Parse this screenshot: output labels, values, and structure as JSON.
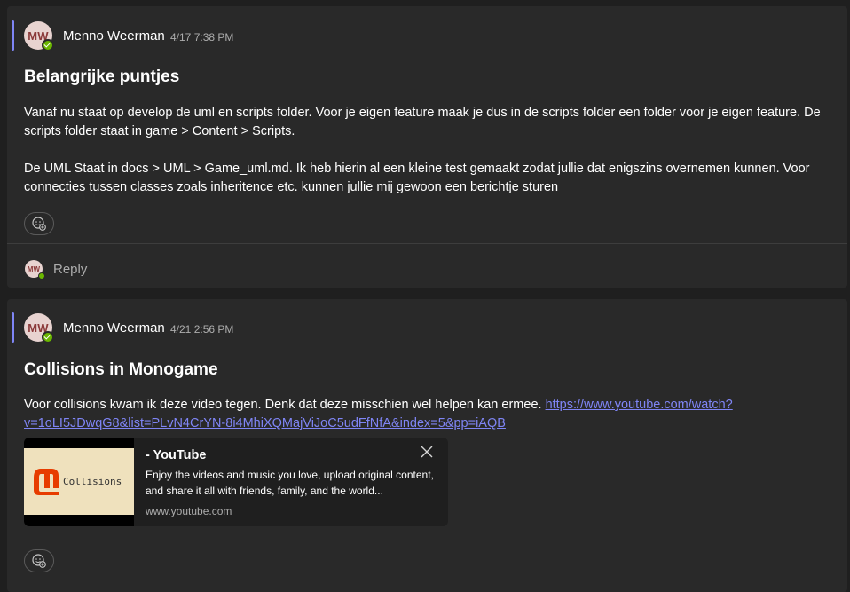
{
  "colors": {
    "accent": "#7f85f5",
    "presence": "#6bb700",
    "background": "#1f1f1f",
    "card": "#292929"
  },
  "posts": [
    {
      "author": {
        "initials": "MW",
        "name": "Menno Weerman"
      },
      "timestamp": "4/17 7:38 PM",
      "subject": "Belangrijke puntjes",
      "paragraphs": [
        "Vanaf nu staat op develop de uml en scripts folder. Voor je eigen feature maak je dus in de scripts folder een folder voor je eigen feature. De scripts folder staat in game > Content > Scripts.",
        "De UML Staat in docs > UML > Game_uml.md. Ik heb hierin al een kleine test gemaakt zodat jullie dat enigszins overnemen kunnen. Voor connecties tussen classes zoals inheritence etc. kunnen jullie mij gewoon een berichtje sturen"
      ],
      "reaction_icon": "add-reaction-icon",
      "reply": {
        "initials": "MW",
        "label": "Reply"
      }
    },
    {
      "author": {
        "initials": "MW",
        "name": "Menno Weerman"
      },
      "timestamp": "4/21 2:56 PM",
      "subject": "Collisions in Monogame",
      "text": "Voor collisions kwam ik deze video tegen. Denk dat deze misschien wel helpen kan ermee. ",
      "link": "https://www.youtube.com/watch?v=1oLI5JDwqG8&list=PLvN4CrYN-8i4MhiXQMajViJoC5udFfNfA&index=5&pp=iAQB",
      "preview": {
        "thumbnail_text": "Collisions",
        "title": "- YouTube",
        "description": "Enjoy the videos and music you love, upload original content, and share it all with friends, family, and the world...",
        "domain": "www.youtube.com"
      },
      "reaction_icon": "add-reaction-icon"
    }
  ]
}
